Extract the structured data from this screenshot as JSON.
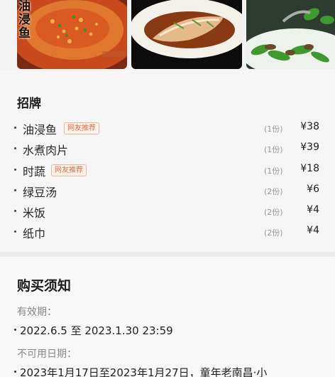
{
  "photos": {
    "first_caption": "油浸鱼",
    "items": [
      {
        "name": "photo-fish-in-oil"
      },
      {
        "name": "photo-steamed-fish"
      },
      {
        "name": "photo-stir-fried-greens"
      }
    ]
  },
  "menu": {
    "title": "招牌",
    "items": [
      {
        "name": "油浸鱼",
        "tag": "网友推荐",
        "qty": "(1份)",
        "price": "¥38"
      },
      {
        "name": "水煮肉片",
        "tag": "",
        "qty": "(1份)",
        "price": "¥39"
      },
      {
        "name": "时蔬",
        "tag": "网友推荐",
        "qty": "(1份)",
        "price": "¥18"
      },
      {
        "name": "绿豆汤",
        "tag": "",
        "qty": "(2份)",
        "price": "¥6"
      },
      {
        "name": "米饭",
        "tag": "",
        "qty": "(2份)",
        "price": "¥4"
      },
      {
        "name": "纸巾",
        "tag": "",
        "qty": "(2份)",
        "price": "¥4"
      }
    ]
  },
  "notes": {
    "title": "购买须知",
    "validity_label": "有效期：",
    "validity_value": "2022.6.5 至 2023.1.30 23:59",
    "unavailable_label": "不可用日期：",
    "unavailable_value": "2023年1月17日至2023年1月27日，童年老南昌·小"
  }
}
